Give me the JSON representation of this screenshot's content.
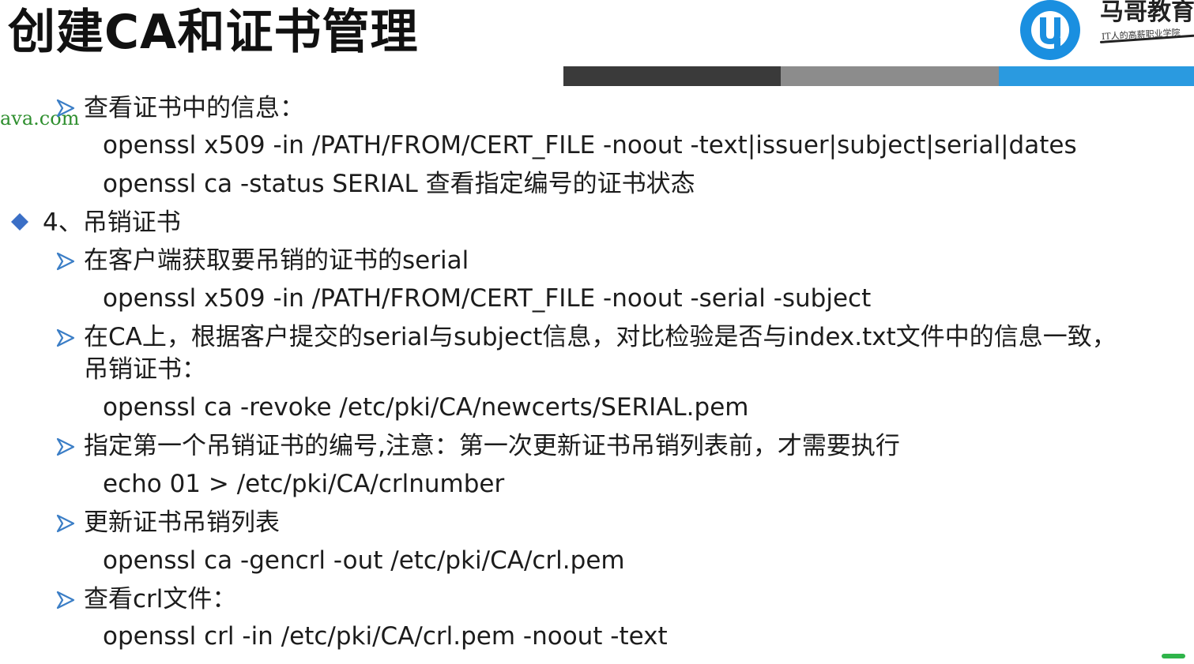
{
  "title": "创建CA和证书管理",
  "logo": {
    "name": "马哥教育",
    "tagline": "IT人的高薪职业学院",
    "accent_color": "#1a8fe0"
  },
  "watermark": "ava.com",
  "stripe_colors": [
    "#3a3a3a",
    "#8c8c8c",
    "#2a9ae0"
  ],
  "items": [
    {
      "text": "查看证书中的信息："
    },
    {
      "text": "openssl x509 -in /PATH/FROM/CERT_FILE -noout   -text|issuer|subject|serial|dates"
    },
    {
      "text": "openssl  ca -status SERIAL  查看指定编号的证书状态"
    },
    {
      "text": "4、吊销证书"
    },
    {
      "text": "在客户端获取要吊销的证书的serial"
    },
    {
      "text": "openssl x509 -in /PATH/FROM/CERT_FILE   -noout   -serial  -subject"
    },
    {
      "text": "在CA上，根据客户提交的serial与subject信息，对比检验是否与index.txt文件中的信息一致，"
    },
    {
      "text": "吊销证书："
    },
    {
      "text": "openssl ca -revoke /etc/pki/CA/newcerts/SERIAL.pem"
    },
    {
      "text": "指定第一个吊销证书的编号,注意：第一次更新证书吊销列表前，才需要执行"
    },
    {
      "text": "echo 01 > /etc/pki/CA/crlnumber"
    },
    {
      "text": "更新证书吊销列表"
    },
    {
      "text": "openssl ca -gencrl -out /etc/pki/CA/crl.pem"
    },
    {
      "text": "查看crl文件："
    },
    {
      "text": "openssl crl -in /etc/pki/CA/crl.pem -noout -text"
    }
  ]
}
